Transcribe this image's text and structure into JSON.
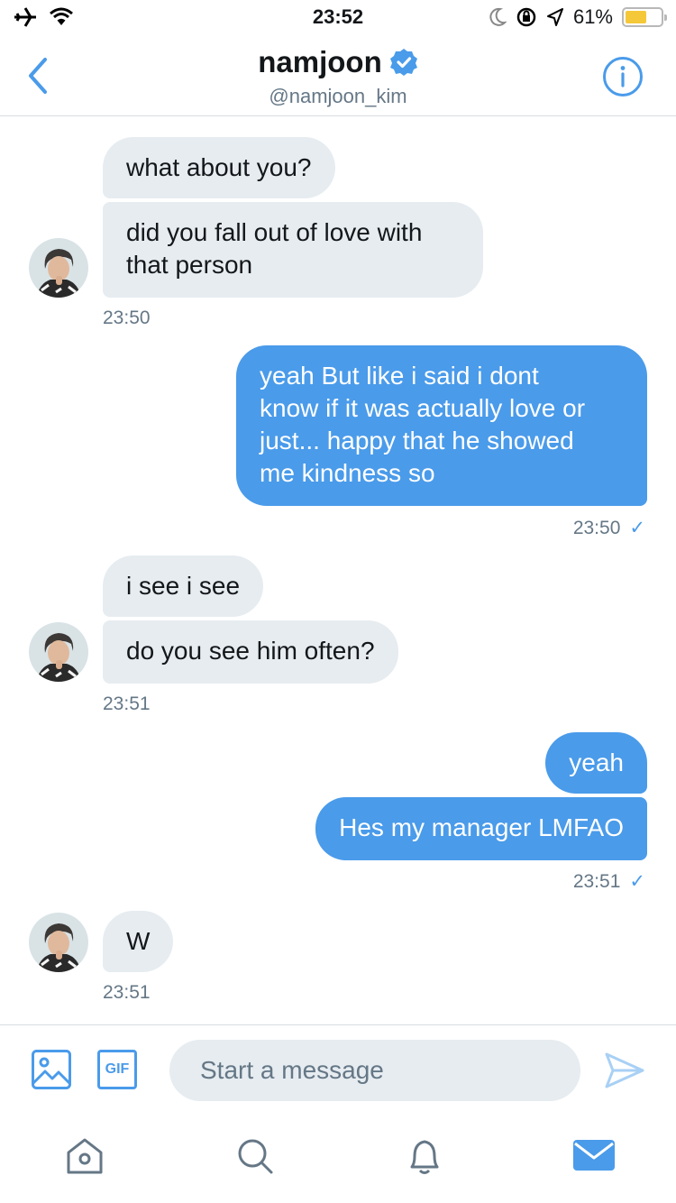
{
  "status_bar": {
    "time": "23:52",
    "battery": "61%"
  },
  "header": {
    "name": "namjoon",
    "handle": "@namjoon_kim"
  },
  "messages": {
    "m1": "what about you?",
    "m2": "did you fall out of love with\nthat person",
    "t1": "23:50",
    "m3": "yeah But like i said i dont\nknow if it was actually love or\njust... happy that he showed\nme kindness so",
    "t2": "23:50",
    "m4": "i see i see",
    "m5": "do you see him often?",
    "t3": "23:51",
    "m6": "yeah",
    "m7": "Hes my manager LMFAO",
    "t4": "23:51",
    "m8": "W",
    "t5": "23:51"
  },
  "composer": {
    "placeholder": "Start a message",
    "gif_label": "GIF"
  },
  "colors": {
    "accent": "#4a9bea",
    "incoming_bubble": "#e6ecf0",
    "muted_text": "#657786"
  },
  "icons": [
    "airplane-icon",
    "wifi-icon",
    "moon-icon",
    "rotation-lock-icon",
    "location-icon",
    "battery-icon",
    "back-chevron-icon",
    "verified-badge-icon",
    "info-icon",
    "image-icon",
    "gif-icon",
    "send-icon",
    "home-icon",
    "search-icon",
    "bell-icon",
    "mail-icon"
  ]
}
